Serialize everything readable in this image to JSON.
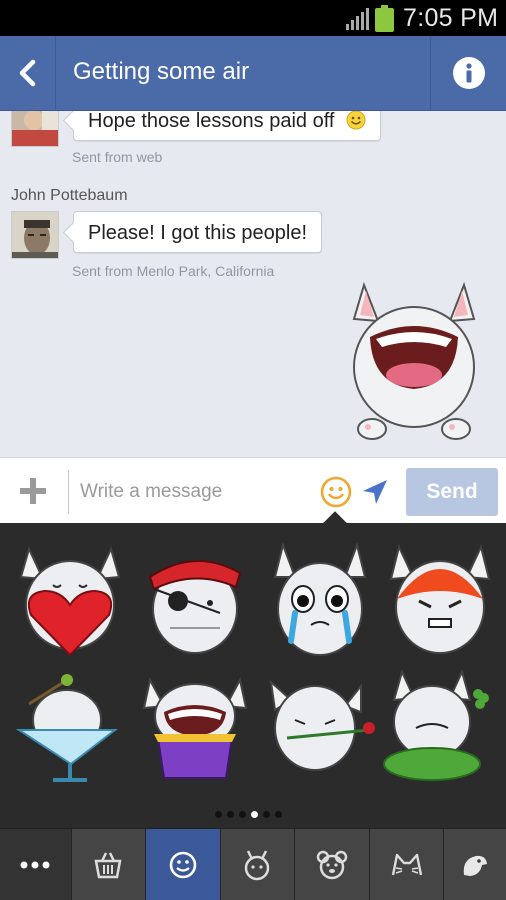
{
  "status_bar": {
    "time": "7:05 PM",
    "signal_icon": "cellular-signal-icon",
    "battery_icon": "battery-charging-icon",
    "battery_color": "#8dc63f"
  },
  "header": {
    "title": "Getting some air",
    "back_icon": "back-arrow-icon",
    "info_icon": "info-icon",
    "color": "#4a6aa8"
  },
  "messages": [
    {
      "text": "Hope those lessons paid off",
      "emoji": "smiley-emoji-icon",
      "meta": "Sent from web"
    },
    {
      "sender": "John Pottebaum",
      "text": "Please! I got this people!",
      "meta": "Sent from Menlo Park, California"
    }
  ],
  "composer": {
    "placeholder": "Write a message",
    "send_label": "Send",
    "send_color": "#b7c7e2",
    "add_icon": "plus-icon",
    "sticker_icon": "smiley-face-icon",
    "location_icon": "location-arrow-icon"
  },
  "sticker_tray": {
    "stickers": [
      "bunny-heart-sticker",
      "bunny-pirate-sticker",
      "bunny-crying-sticker",
      "bunny-angry-sticker",
      "bunny-martini-sticker",
      "bunny-cake-sticker",
      "bunny-rose-sticker",
      "bunny-clover-sticker"
    ],
    "page_count": 6,
    "active_page": 4
  },
  "tabs": [
    {
      "name": "more",
      "icon": "more-dots-icon"
    },
    {
      "name": "basket",
      "icon": "sticker-store-basket-icon"
    },
    {
      "name": "emoticons",
      "icon": "smiley-face-icon",
      "active": true
    },
    {
      "name": "pack-2",
      "icon": "bunny-face-icon"
    },
    {
      "name": "pack-3",
      "icon": "bear-face-icon"
    },
    {
      "name": "pack-4",
      "icon": "cat-face-icon"
    },
    {
      "name": "pack-5",
      "icon": "bird-icon"
    }
  ]
}
